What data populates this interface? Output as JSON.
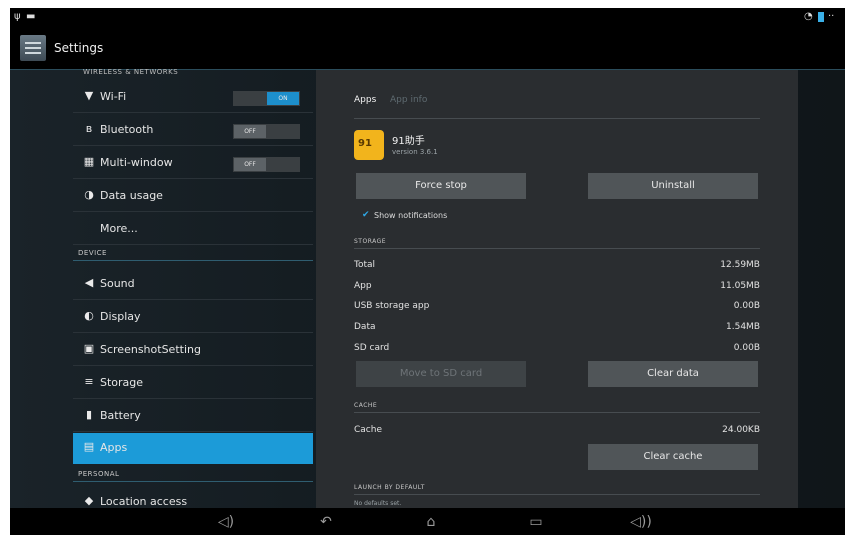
{
  "status_bar": {
    "icons": [
      "signal-icon",
      "battery-icon"
    ]
  },
  "action_bar": {
    "title": "Settings",
    "icon": "settings-icon"
  },
  "sidebar": {
    "cut_header": "WIRELESS & NETWORKS",
    "wireless_items": [
      {
        "label": "Wi-Fi",
        "icon": "wifi-icon",
        "toggle": "ON"
      },
      {
        "label": "Bluetooth",
        "icon": "bluetooth-icon",
        "toggle": "OFF"
      },
      {
        "label": "Multi-window",
        "icon": "multi-window-icon",
        "toggle": "OFF"
      },
      {
        "label": "Data usage",
        "icon": "data-usage-icon"
      },
      {
        "label": "More..."
      }
    ],
    "device_header": "DEVICE",
    "device_items": [
      {
        "label": "Sound",
        "icon": "sound-icon"
      },
      {
        "label": "Display",
        "icon": "display-icon"
      },
      {
        "label": "ScreenshotSetting",
        "icon": "screenshot-icon"
      },
      {
        "label": "Storage",
        "icon": "storage-icon"
      },
      {
        "label": "Battery",
        "icon": "battery-icon"
      },
      {
        "label": "Apps",
        "icon": "apps-icon",
        "selected": true
      }
    ],
    "personal_header": "PERSONAL",
    "personal_items": [
      {
        "label": "Location access",
        "icon": "location-icon"
      }
    ]
  },
  "detail": {
    "breadcrumb": {
      "apps": "Apps",
      "app_info": "App info"
    },
    "app": {
      "name": "91助手",
      "version": "version 3.6.1"
    },
    "buttons": {
      "force_stop": "Force stop",
      "uninstall": "Uninstall",
      "move": "Move to SD card",
      "clear_data": "Clear data",
      "clear_cache": "Clear cache"
    },
    "show_notifications": {
      "label": "Show notifications",
      "checked": true
    },
    "storage": {
      "header": "STORAGE",
      "rows": [
        {
          "label": "Total",
          "value": "12.59MB"
        },
        {
          "label": "App",
          "value": "11.05MB"
        },
        {
          "label": "USB storage app",
          "value": "0.00B"
        },
        {
          "label": "Data",
          "value": "1.54MB"
        },
        {
          "label": "SD card",
          "value": "0.00B"
        }
      ]
    },
    "cache": {
      "header": "CACHE",
      "label": "Cache",
      "value": "24.00KB"
    },
    "launch": {
      "header": "LAUNCH BY DEFAULT",
      "text": "No defaults set."
    }
  },
  "nav_bar": {
    "icons": [
      "volume-down-icon",
      "back-icon",
      "home-icon",
      "recents-icon",
      "volume-up-icon"
    ]
  },
  "colors": {
    "accent": "#1c9bd8",
    "toggle_on": "#1d8fcc",
    "checkbox": "#2ea8e6"
  }
}
